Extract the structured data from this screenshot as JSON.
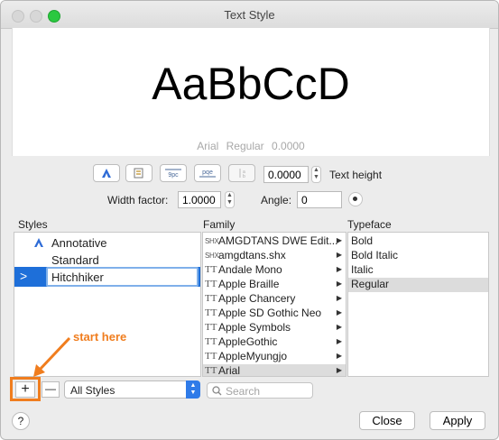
{
  "window": {
    "title": "Text Style"
  },
  "preview": {
    "sample_text": "AaBbCcD",
    "font_name": "Arial",
    "font_style": "Regular",
    "font_size": "0.0000"
  },
  "toolbar": {
    "text_height_value": "0.0000",
    "text_height_label": "Text height"
  },
  "properties": {
    "width_factor_label": "Width factor:",
    "width_factor_value": "1.0000",
    "angle_label": "Angle:",
    "angle_value": "0"
  },
  "columns": {
    "styles": "Styles",
    "family": "Family",
    "typeface": "Typeface"
  },
  "styles": [
    {
      "label": "Annotative",
      "annotative": true
    },
    {
      "label": "Standard"
    },
    {
      "label": "Hitchhiker",
      "selected": true,
      "editing": true
    }
  ],
  "families": [
    {
      "name": "AMGDTANS DWE Edit...",
      "icon": "SHX"
    },
    {
      "name": "amgdtans.shx",
      "icon": "SHX"
    },
    {
      "name": "Andale Mono",
      "icon": "TT"
    },
    {
      "name": "Apple Braille",
      "icon": "TT"
    },
    {
      "name": "Apple Chancery",
      "icon": "TT"
    },
    {
      "name": "Apple SD Gothic Neo",
      "icon": "TT"
    },
    {
      "name": "Apple Symbols",
      "icon": "TT"
    },
    {
      "name": "AppleGothic",
      "icon": "TT"
    },
    {
      "name": "AppleMyungjo",
      "icon": "TT"
    },
    {
      "name": "Arial",
      "icon": "TT",
      "selected": true
    }
  ],
  "typefaces": [
    {
      "name": "Bold"
    },
    {
      "name": "Bold Italic"
    },
    {
      "name": "Italic"
    },
    {
      "name": "Regular",
      "selected": true
    }
  ],
  "bottom": {
    "add": "+",
    "remove": "—",
    "filter_value": "All Styles",
    "search_placeholder": "Search",
    "help": "?",
    "close": "Close",
    "apply": "Apply"
  },
  "annotation": {
    "text": "start here",
    "color": "#f07d1e"
  },
  "colors": {
    "selection_blue": "#1e6fd9",
    "selection_gray": "#dcdcdc",
    "annotative_blue": "#2e6bd6"
  }
}
